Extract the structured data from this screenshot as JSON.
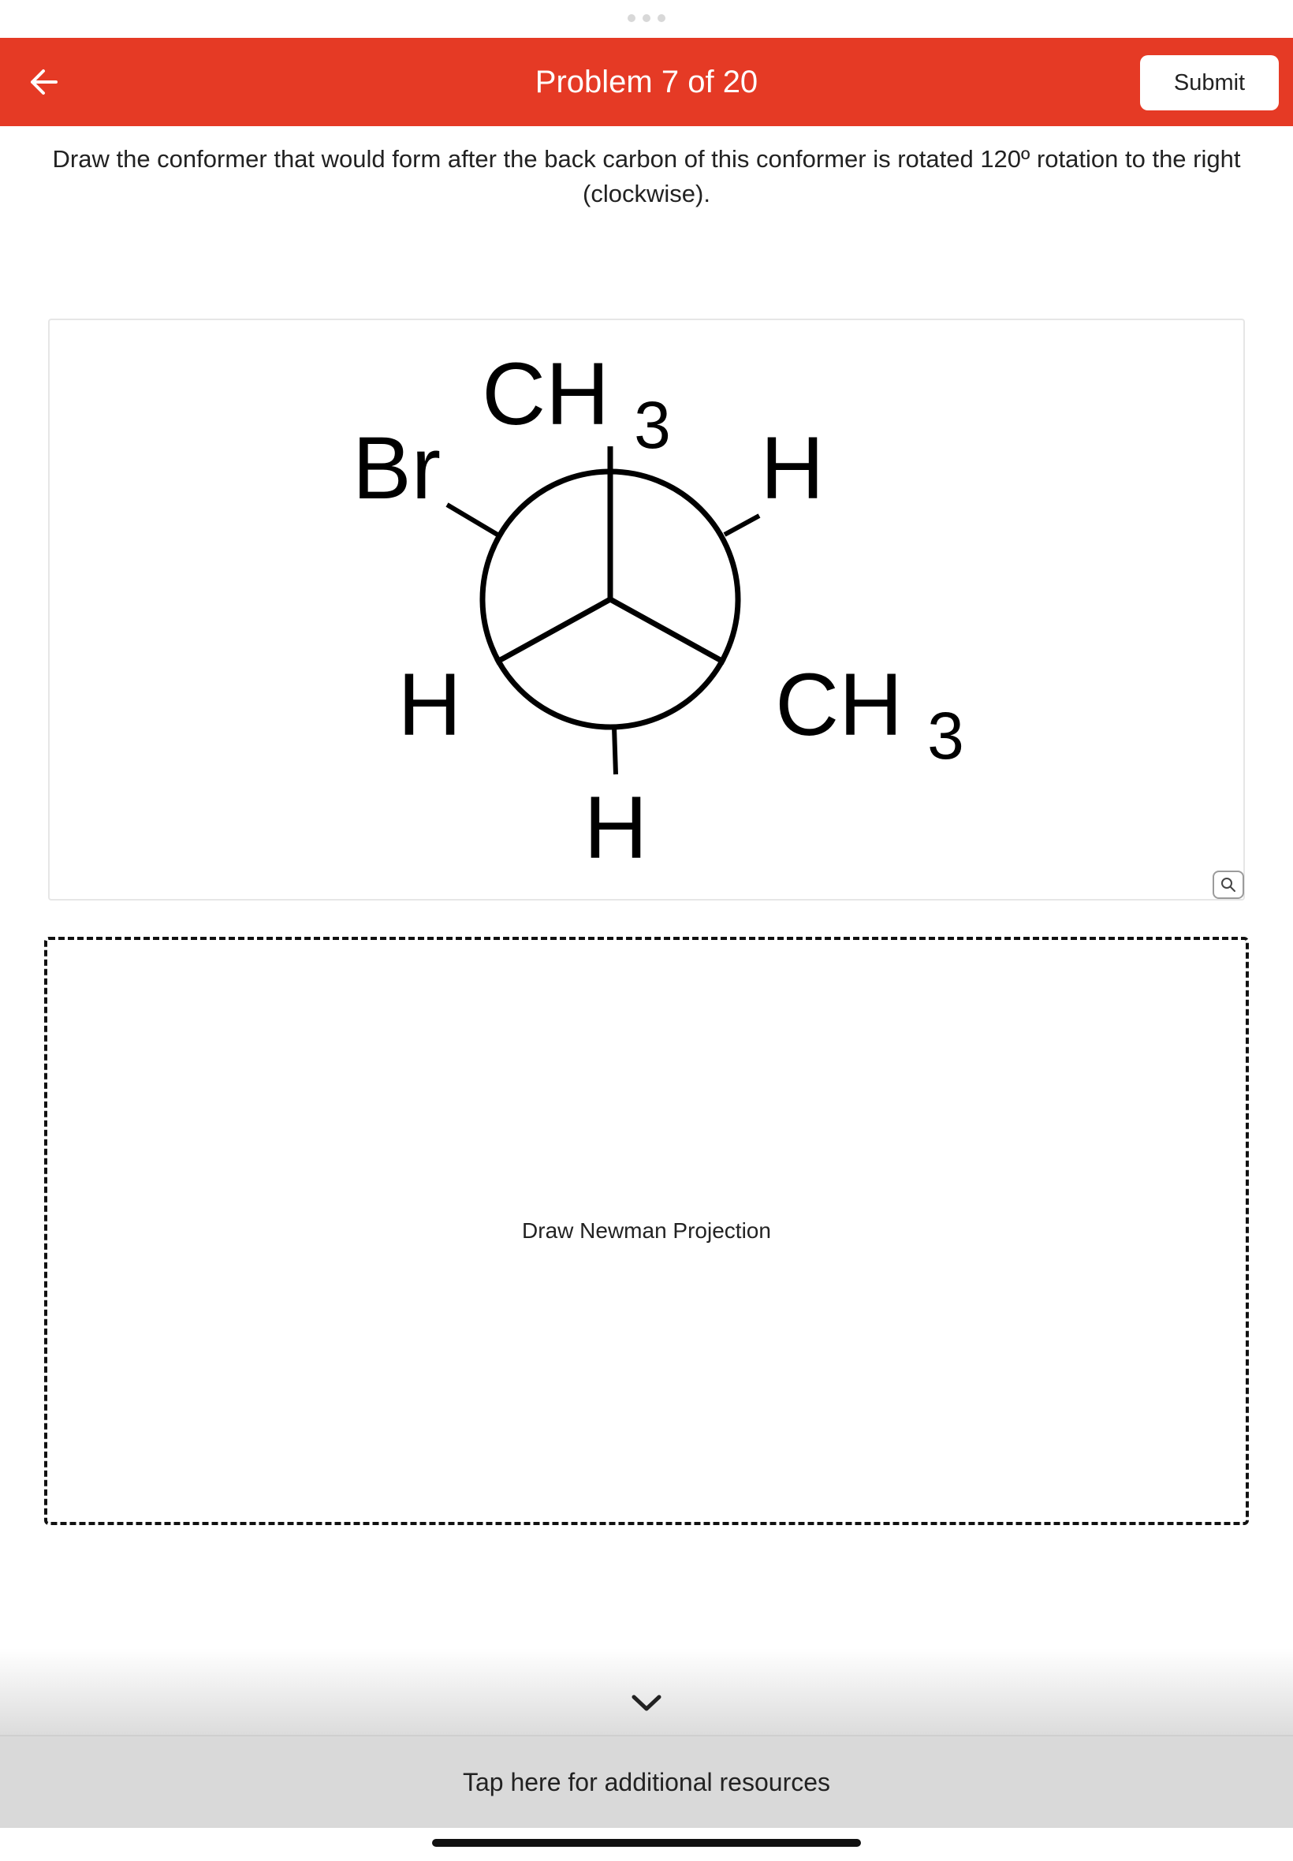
{
  "header": {
    "back_icon": "arrow-left-icon",
    "title": "Problem 7 of 20",
    "submit_label": "Submit",
    "accent_color": "#e53a25"
  },
  "prompt": {
    "text": "Draw the conformer that would form after the back carbon of this conformer is rotated 120º rotation to the right (clockwise)."
  },
  "newman_projection": {
    "front_carbon": {
      "top": "CH3",
      "lower_left": "H",
      "lower_right": "CH3"
    },
    "back_carbon": {
      "upper_left": "Br",
      "upper_right": "H",
      "bottom": "H"
    },
    "zoom_icon": "magnifier-icon"
  },
  "drawing_area": {
    "label": "Draw Newman Projection"
  },
  "resources": {
    "chevron_icon": "chevron-down-icon",
    "label": "Tap here for additional resources"
  }
}
